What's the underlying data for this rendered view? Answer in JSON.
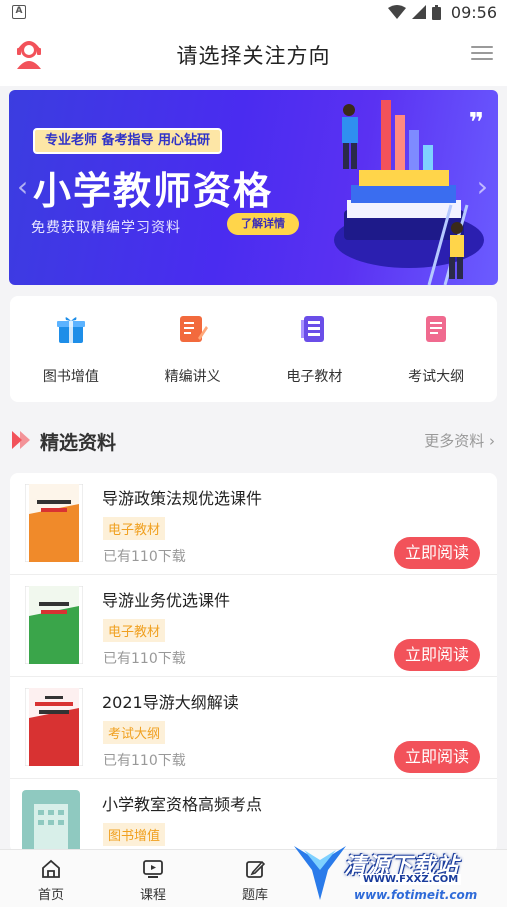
{
  "status_bar": {
    "time": "09:56",
    "notif_letter": "A"
  },
  "header": {
    "title": "请选择关注方向"
  },
  "banner": {
    "tagline": "专业老师 备考指导 用心钻研",
    "title_part1": "小学教",
    "title_part2": "师资格",
    "subtitle": "免费获取精编学习资料",
    "button": "了解详情",
    "quote_mark": "❞"
  },
  "categories": [
    {
      "label": "图书增值",
      "icon": "gift-icon",
      "color": "#1e8ee8"
    },
    {
      "label": "精编讲义",
      "icon": "notes-icon",
      "color": "#f26a3d"
    },
    {
      "label": "电子教材",
      "icon": "ebook-icon",
      "color": "#6a4ee8"
    },
    {
      "label": "考试大纲",
      "icon": "outline-icon",
      "color": "#f06a8f"
    }
  ],
  "section": {
    "title": "精选资料",
    "more": "更多资料 ›"
  },
  "materials": [
    {
      "name": "导游政策法规优选课件",
      "tag": "电子教材",
      "downloads": "已有110下载",
      "button": "立即阅读",
      "cover_color": "#f08a2a",
      "cover_text": "导游政策法规\n优选课件"
    },
    {
      "name": "导游业务优选课件",
      "tag": "电子教材",
      "downloads": "已有110下载",
      "button": "立即阅读",
      "cover_color": "#3aa54a",
      "cover_text": "导游业务\n优选课件"
    },
    {
      "name": "2021导游大纲解读",
      "tag": "考试大纲",
      "downloads": "已有110下载",
      "button": "立即阅读",
      "cover_color": "#d83232",
      "cover_text": "2021\n大纲解读"
    },
    {
      "name": "小学教室资格高频考点",
      "tag": "图书增值",
      "downloads": "",
      "button": "",
      "cover_color": "#8fc9c0",
      "cover_text": ""
    }
  ],
  "bottom_nav": [
    {
      "label": "首页",
      "icon": "home-icon"
    },
    {
      "label": "课程",
      "icon": "video-icon"
    },
    {
      "label": "题库",
      "icon": "edit-icon"
    }
  ],
  "watermark": {
    "text": "清源下载站",
    "url1": "WWW.FXXZ.COM",
    "url2": "www.fotimeit.com"
  },
  "colors": {
    "accent": "#f2525a",
    "banner": "#4a2cf0",
    "tag_bg": "#fdf0d8",
    "tag_fg": "#f0a020"
  }
}
